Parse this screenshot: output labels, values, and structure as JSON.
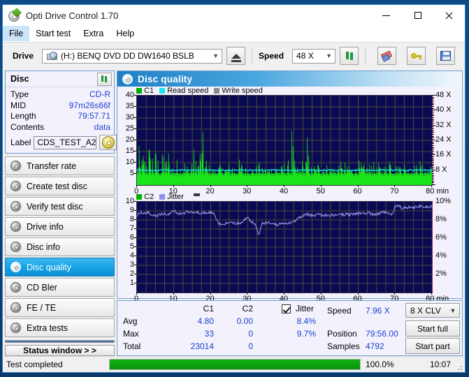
{
  "window": {
    "title": "Opti Drive Control 1.70",
    "icon": "opti-drive-icon",
    "minimize": "minimize-icon",
    "maximize": "maximize-icon",
    "close": "close-icon"
  },
  "menu": {
    "items": [
      "File",
      "Start test",
      "Extra",
      "Help"
    ],
    "active": "File"
  },
  "toolbar": {
    "drive_label": "Drive",
    "drive_value": "(H:)  BENQ DVD DD DW1640 BSLB",
    "eject_icon": "eject-icon",
    "speed_label": "Speed",
    "speed_value": "48 X",
    "refresh_icon": "refresh-icon",
    "erase_icon": "eraser-icon",
    "key_icon": "key-icon",
    "save_icon": "save-icon"
  },
  "disc_panel": {
    "title": "Disc",
    "refresh_icon": "refresh-icon",
    "rows": [
      {
        "key": "Type",
        "value": "CD-R"
      },
      {
        "key": "MID",
        "value": "97m26s66f"
      },
      {
        "key": "Length",
        "value": "79:57.71"
      },
      {
        "key": "Contents",
        "value": "data"
      }
    ],
    "label_key": "Label",
    "label_value": "CDS_TEST_A2",
    "cd_icon": "cd-disc-icon"
  },
  "nav": {
    "items": [
      {
        "label": "Transfer rate",
        "selected": false
      },
      {
        "label": "Create test disc",
        "selected": false
      },
      {
        "label": "Verify test disc",
        "selected": false
      },
      {
        "label": "Drive info",
        "selected": false
      },
      {
        "label": "Disc info",
        "selected": false
      },
      {
        "label": "Disc quality",
        "selected": true
      },
      {
        "label": "CD Bler",
        "selected": false
      },
      {
        "label": "FE / TE",
        "selected": false
      },
      {
        "label": "Extra tests",
        "selected": false
      }
    ],
    "status_window": "Status window > >"
  },
  "panel": {
    "title": "Disc quality",
    "icon": "disc-quality-icon"
  },
  "stats": {
    "headers": {
      "c1": "C1",
      "c2": "C2",
      "jitter": "Jitter"
    },
    "rows": [
      {
        "name": "Avg",
        "c1": "4.80",
        "c2": "0.00",
        "jitter": "8.4%"
      },
      {
        "name": "Max",
        "c1": "33",
        "c2": "0",
        "jitter": "9.7%"
      },
      {
        "name": "Total",
        "c1": "23014",
        "c2": "0",
        "jitter": ""
      }
    ],
    "jitter_checked": true,
    "speed_label": "Speed",
    "speed_value": "7.96 X",
    "position_label": "Position",
    "position_value": "79:56.00",
    "samples_label": "Samples",
    "samples_value": "4792",
    "write_speed_select": "8 X CLV",
    "start_full": "Start full",
    "start_part": "Start part"
  },
  "statusbar": {
    "message": "Test completed",
    "progress_percent": "100.0%",
    "progress_value": 100,
    "elapsed": "10:07"
  },
  "chart_data": [
    {
      "id": "c1-chart",
      "type": "line",
      "title": "",
      "xlabel": "min",
      "ylabel": "C1",
      "xlim": [
        0,
        80
      ],
      "ylim": [
        0,
        40
      ],
      "xticks": [
        0,
        10,
        20,
        30,
        40,
        50,
        60,
        70,
        80
      ],
      "xticklabels": [
        "0",
        "10",
        "20",
        "30",
        "40",
        "50",
        "60",
        "70",
        "80 min"
      ],
      "yticks": [
        5,
        10,
        15,
        20,
        25,
        30,
        35,
        40
      ],
      "yticklabels": [
        "5",
        "10",
        "15",
        "20",
        "25",
        "30",
        "35",
        "40"
      ],
      "y2lim": [
        0,
        48
      ],
      "y2ticks": [
        8,
        16,
        24,
        32,
        40,
        48
      ],
      "y2ticklabels": [
        "8 X",
        "16 X",
        "24 X",
        "32 X",
        "40 X",
        "48 X"
      ],
      "grid": true,
      "background": "#0a0a52",
      "legend": [
        {
          "name": "C1",
          "color": "#00b000"
        },
        {
          "name": "Read speed",
          "color": "#19e6f0"
        },
        {
          "name": "Write speed",
          "color": "#8a8a8a"
        }
      ],
      "series": [
        {
          "name": "C1",
          "color": "#19e619",
          "kind": "filled-spikes",
          "baseline_avg": 4.8,
          "max": 33,
          "total": 23014,
          "x": [
            0,
            0.6,
            1.2,
            1.8,
            2.4,
            3,
            3.6,
            4.2,
            4.8,
            5.4,
            6,
            6.6,
            7.2,
            7.8,
            8.4,
            9,
            9.6,
            10.2,
            10.8,
            11.4,
            12,
            12.6,
            13.2,
            13.8,
            14.4,
            15,
            15.6,
            16.2,
            16.8,
            17.4,
            18,
            18.6,
            19.2,
            19.8,
            20.4,
            21,
            21.6,
            22.2,
            22.8,
            23.4,
            24,
            24.6,
            25.2,
            25.8,
            26.4,
            27,
            27.6,
            28.2,
            28.8,
            29.4,
            30,
            30.6,
            31.2,
            31.8,
            32.4,
            33,
            33.6,
            34.2,
            34.8,
            35.4,
            36,
            36.6,
            37.2,
            37.8,
            38.4,
            39,
            39.6,
            40.2,
            40.8,
            41.4,
            42,
            42.6,
            43.2,
            43.8,
            44.4,
            45,
            45.6,
            46.2,
            46.8,
            47.4,
            48,
            48.6,
            49.2,
            49.8,
            50.4,
            51,
            51.6,
            52.2,
            52.8,
            53.4,
            54,
            54.6,
            55.2,
            55.8,
            56.4,
            57,
            57.6,
            58.2,
            58.8,
            59.4,
            60,
            60.6,
            61.2,
            61.8,
            62.4,
            63,
            63.6,
            64.2,
            64.8,
            65.4,
            66,
            66.6,
            67.2,
            67.8,
            68.4,
            69,
            69.6,
            70.2,
            70.8,
            71.4,
            72,
            72.6,
            73.2,
            73.8,
            74.4,
            75,
            75.6,
            76.2,
            76.8,
            77.4,
            78,
            78.6,
            79.2,
            79.8
          ],
          "y": [
            13,
            17,
            12,
            20,
            14,
            33,
            16,
            22,
            15,
            21,
            10,
            8,
            23,
            12,
            22,
            13,
            9,
            11,
            12,
            14,
            10,
            19,
            9,
            11,
            8,
            25,
            13,
            12,
            20,
            24,
            22,
            16,
            10,
            9,
            8,
            7,
            9,
            11,
            8,
            10,
            9,
            12,
            8,
            14,
            9,
            8,
            11,
            13,
            9,
            8,
            10,
            9,
            8,
            7,
            9,
            11,
            8,
            7,
            9,
            8,
            10,
            9,
            8,
            11,
            9,
            8,
            10,
            12,
            9,
            14,
            31,
            11,
            9,
            8,
            10,
            13,
            9,
            24,
            11,
            8,
            10,
            9,
            12,
            8,
            18,
            9,
            10,
            8,
            11,
            9,
            8,
            13,
            10,
            9,
            11,
            8,
            16,
            9,
            10,
            8,
            12,
            9,
            11,
            8,
            10,
            9,
            17,
            10,
            8,
            9,
            11,
            8,
            10,
            9,
            32,
            12,
            9,
            11,
            8,
            14,
            9,
            12,
            10,
            8,
            11,
            9,
            10,
            8,
            12,
            9,
            11,
            8,
            10,
            9
          ]
        },
        {
          "name": "Read speed",
          "color": "#19e6f0",
          "kind": "line",
          "x": [
            0,
            80
          ],
          "y_in_x_units": [
            7.96,
            7.96
          ]
        }
      ]
    },
    {
      "id": "jitter-chart",
      "type": "line",
      "title": "",
      "xlabel": "min",
      "ylabel": "C2",
      "xlim": [
        0,
        80
      ],
      "ylim": [
        0,
        10
      ],
      "xticks": [
        0,
        10,
        20,
        30,
        40,
        50,
        60,
        70,
        80
      ],
      "xticklabels": [
        "0",
        "10",
        "20",
        "30",
        "40",
        "50",
        "60",
        "70",
        "80 min"
      ],
      "yticks": [
        1,
        2,
        3,
        4,
        5,
        6,
        7,
        8,
        9,
        10
      ],
      "yticklabels": [
        "1",
        "2",
        "3",
        "4",
        "5",
        "6",
        "7",
        "8",
        "9",
        "10"
      ],
      "y2ticks": [
        2,
        4,
        6,
        8,
        10
      ],
      "y2ticklabels": [
        "2%",
        "4%",
        "6%",
        "8%",
        "10%"
      ],
      "grid": true,
      "background": "#0a0a52",
      "legend": [
        {
          "name": "C2",
          "color": "#00b000"
        },
        {
          "name": "Jitter",
          "color": "#8f92e8"
        }
      ],
      "series": [
        {
          "name": "Jitter",
          "color": "#9a9ced",
          "kind": "line",
          "avg": 8.4,
          "max": 9.7,
          "x": [
            0,
            1,
            2,
            3,
            4,
            5,
            6,
            7,
            8,
            9,
            10,
            11,
            12,
            13,
            14,
            15,
            16,
            17,
            18,
            19,
            20,
            21,
            22,
            23,
            24,
            25,
            26,
            27,
            28,
            29,
            30,
            31,
            32,
            33,
            34,
            35,
            36,
            37,
            38,
            39,
            40,
            41,
            42,
            43,
            44,
            45,
            46,
            47,
            48,
            49,
            50,
            51,
            52,
            53,
            54,
            55,
            56,
            57,
            58,
            59,
            60,
            61,
            62,
            63,
            64,
            65,
            66,
            67,
            68,
            69,
            70,
            71,
            72,
            73,
            74,
            75,
            76,
            77,
            78,
            79,
            80
          ],
          "y": [
            8.5,
            8.8,
            8.7,
            8.8,
            8.6,
            8.4,
            8.6,
            8.7,
            8.6,
            8.7,
            9.0,
            8.8,
            8.6,
            8.8,
            8.9,
            8.7,
            8.9,
            8.8,
            8.8,
            8.8,
            8.8,
            8.7,
            7.6,
            7.6,
            7.6,
            7.6,
            7.7,
            7.6,
            7.7,
            8.0,
            8.2,
            7.8,
            7.6,
            6.3,
            7.6,
            7.7,
            7.7,
            7.6,
            7.5,
            7.6,
            7.6,
            7.6,
            7.7,
            7.9,
            8.2,
            8.4,
            8.7,
            8.5,
            8.5,
            8.6,
            8.5,
            8.5,
            8.5,
            8.5,
            8.6,
            8.5,
            8.6,
            8.6,
            8.6,
            8.7,
            8.7,
            8.8,
            8.8,
            8.7,
            8.6,
            8.6,
            8.8,
            8.9,
            8.8,
            8.5,
            9.5,
            9.5,
            9.3,
            9.4,
            9.4,
            9.3,
            9.5,
            9.5,
            9.4,
            9.5,
            9.4
          ]
        },
        {
          "name": "C2",
          "color": "#00b000",
          "kind": "filled-spikes",
          "x": [],
          "y": []
        }
      ]
    }
  ]
}
